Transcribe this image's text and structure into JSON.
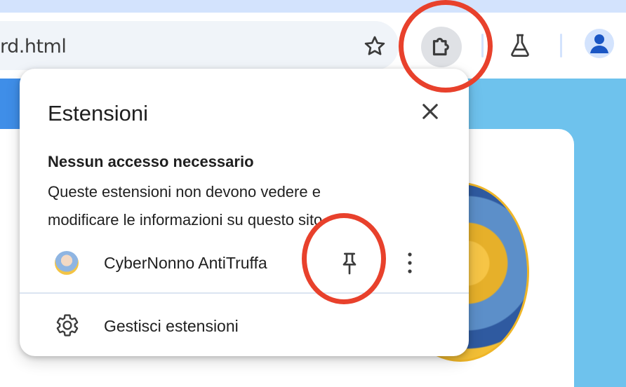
{
  "toolbar": {
    "url_text": "rd.html",
    "bookmark_icon": "star-icon",
    "extensions_icon": "puzzle-piece-icon",
    "labs_icon": "flask-icon",
    "profile_icon": "person-icon"
  },
  "popup": {
    "title": "Estensioni",
    "close_icon": "close-icon",
    "section_title": "Nessun accesso necessario",
    "section_desc": "Queste estensioni non devono vedere e modificare le informazioni su questo sito",
    "extensions": [
      {
        "name": "CyberNonno AntiTruffa",
        "pin_icon": "pin-icon",
        "menu_icon": "more-vert-icon"
      }
    ],
    "manage_label": "Gestisci estensioni",
    "manage_icon": "gear-icon"
  },
  "colors": {
    "tabstrip": "#d3e3fd",
    "omnibox": "#f0f4f9",
    "content_bg": "#6ec2ed",
    "annotation": "#e8412c",
    "text": "#1f1f1f"
  }
}
